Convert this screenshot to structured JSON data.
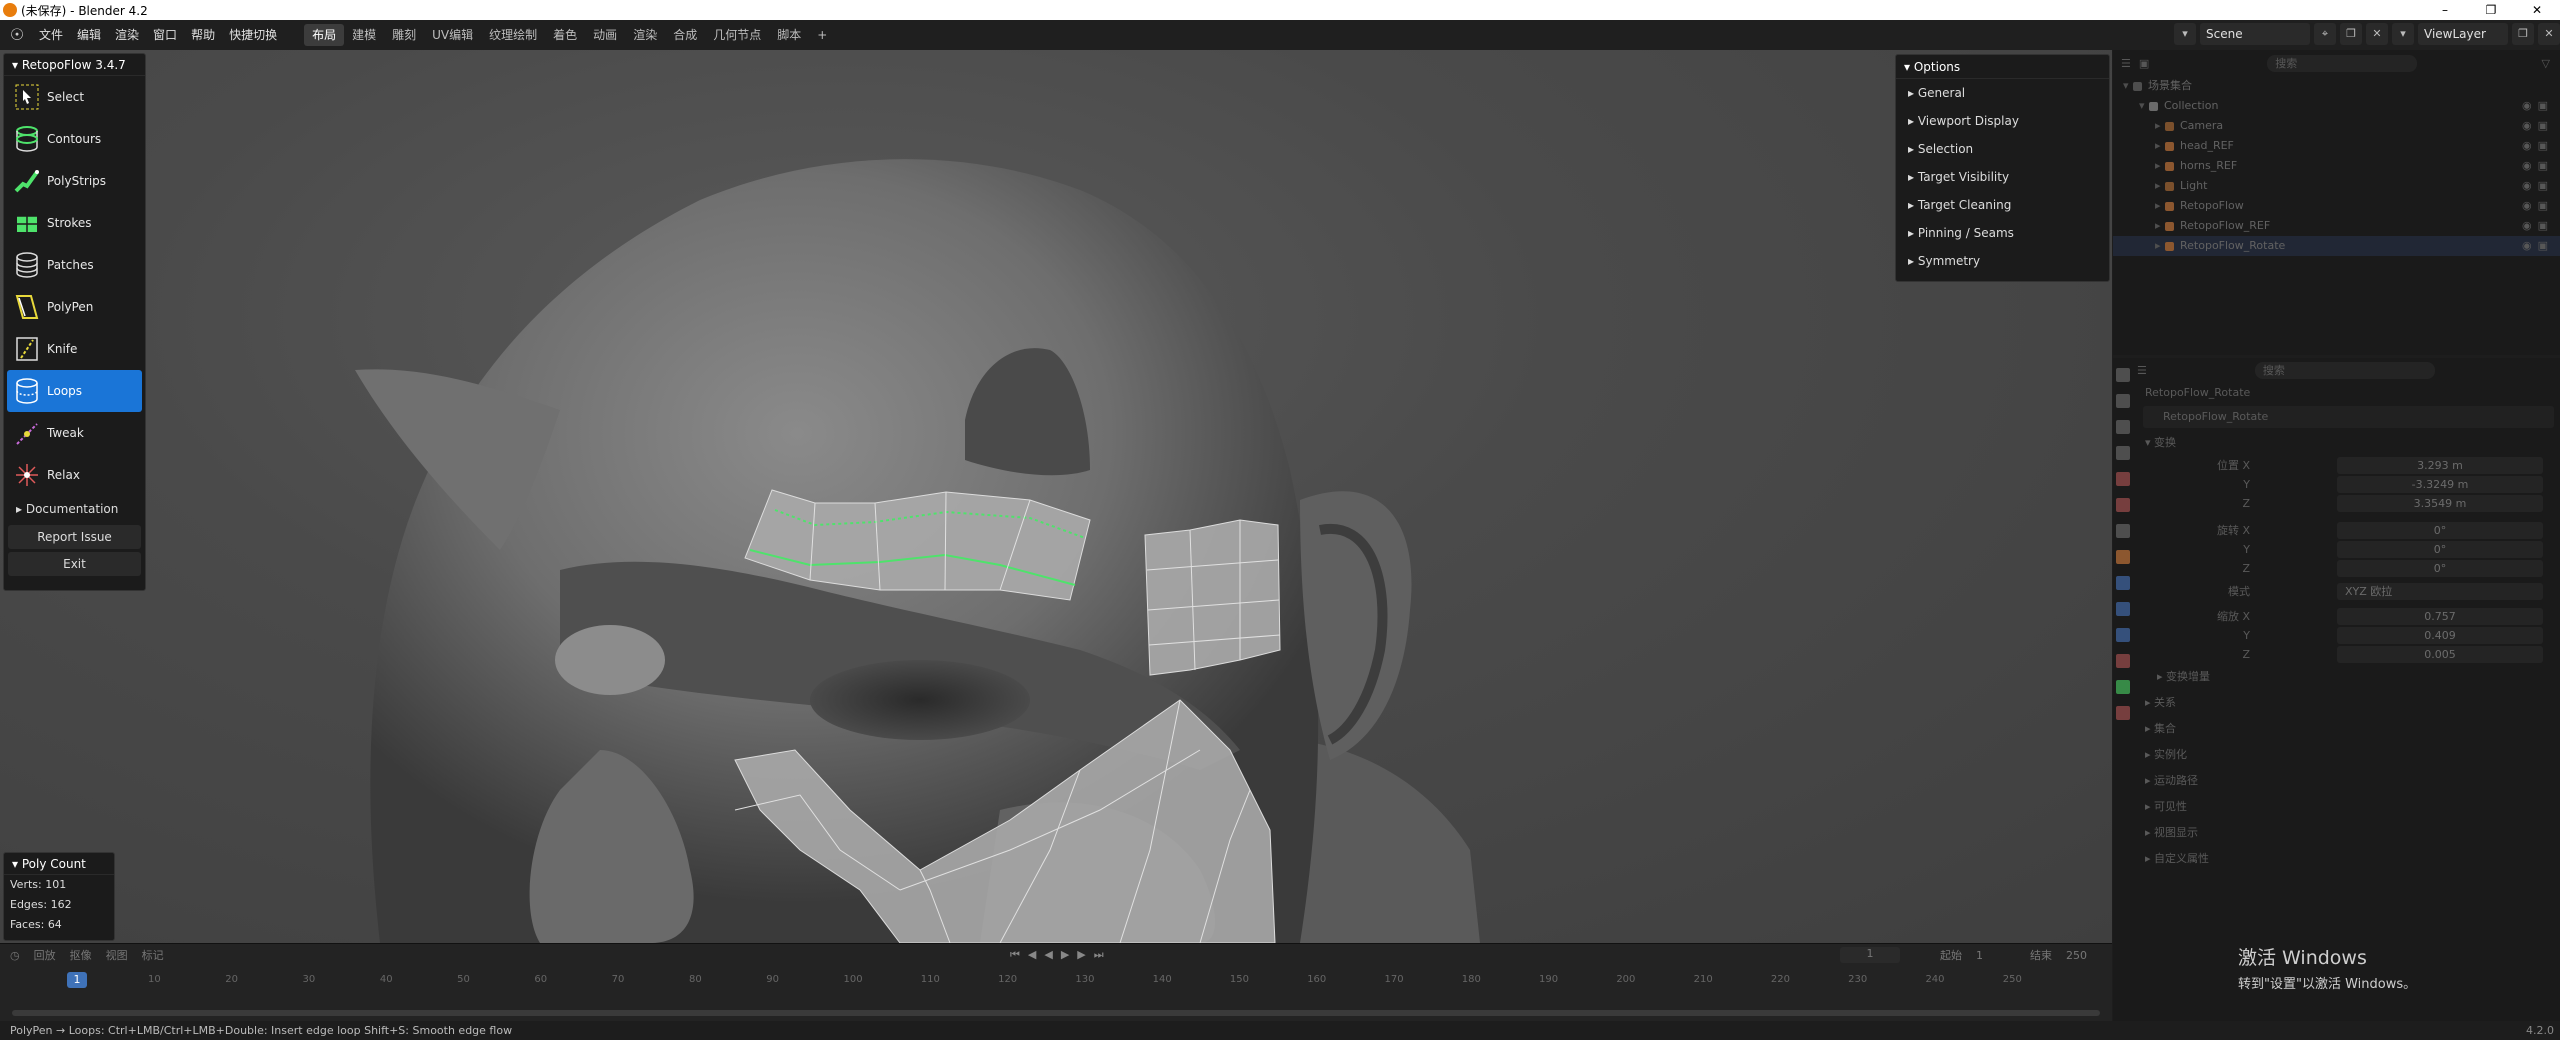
{
  "window": {
    "title": "(未保存) - Blender 4.2",
    "buttons": [
      "–",
      "❐",
      "✕"
    ]
  },
  "menubar": {
    "menus": [
      "文件",
      "编辑",
      "渲染",
      "窗口",
      "帮助",
      "快捷切换"
    ],
    "workspaces": [
      "布局",
      "建模",
      "雕刻",
      "UV编辑",
      "纹理绘制",
      "着色",
      "动画",
      "渲染",
      "合成",
      "几何节点",
      "脚本",
      "+"
    ],
    "active_workspace": "布局",
    "scene": "Scene",
    "view_layer": "ViewLayer"
  },
  "retopoflow": {
    "title": "RetopoFlow 3.4.7",
    "tools": [
      {
        "label": "Select",
        "icon": "select-icon"
      },
      {
        "label": "Contours",
        "icon": "contours-icon"
      },
      {
        "label": "PolyStrips",
        "icon": "polystrips-icon"
      },
      {
        "label": "Strokes",
        "icon": "strokes-icon"
      },
      {
        "label": "Patches",
        "icon": "patches-icon"
      },
      {
        "label": "PolyPen",
        "icon": "polypen-icon"
      },
      {
        "label": "Knife",
        "icon": "knife-icon"
      },
      {
        "label": "Loops",
        "icon": "loops-icon",
        "active": true
      },
      {
        "label": "Tweak",
        "icon": "tweak-icon"
      },
      {
        "label": "Relax",
        "icon": "relax-icon"
      }
    ],
    "documentation": "Documentation",
    "report_issue": "Report Issue",
    "exit": "Exit",
    "accent_color": "#1a75d7",
    "tool_color": "#4ee36b"
  },
  "options": {
    "title": "Options",
    "items": [
      "General",
      "Viewport Display",
      "Selection",
      "Target Visibility",
      "Target Cleaning",
      "Pinning / Seams",
      "Symmetry"
    ]
  },
  "poly_count": {
    "title": "Poly Count",
    "verts_label": "Verts:",
    "verts": "101",
    "edges_label": "Edges:",
    "edges": "162",
    "faces_label": "Faces:",
    "faces": "64"
  },
  "timeline": {
    "menus": [
      "回放",
      "抠像",
      "视图",
      "标记"
    ],
    "current_frame": "1",
    "frame_field": "1",
    "start_label": "起始",
    "start": "1",
    "end_label": "结束",
    "end": "250",
    "ticks": [
      "10",
      "20",
      "30",
      "40",
      "50",
      "60",
      "70",
      "80",
      "90",
      "100",
      "110",
      "120",
      "130",
      "140",
      "150",
      "160",
      "170",
      "180",
      "190",
      "200",
      "210",
      "220",
      "230",
      "240",
      "250"
    ]
  },
  "statusbar": {
    "hint": "PolyPen → Loops: Ctrl+LMB/Ctrl+LMB+Double: Insert edge loop    Shift+S: Smooth edge flow",
    "version": "4.2.0"
  },
  "outliner": {
    "search_placeholder": "搜索",
    "rows": [
      {
        "label": "场景集合",
        "depth": 0,
        "color": "#777777"
      },
      {
        "label": "Collection",
        "depth": 1,
        "color": "#aaaaaa"
      },
      {
        "label": "Camera",
        "depth": 2,
        "color": "#c97a3a"
      },
      {
        "label": "head_REF",
        "depth": 2,
        "color": "#e8873f"
      },
      {
        "label": "horns_REF",
        "depth": 2,
        "color": "#e8873f"
      },
      {
        "label": "Light",
        "depth": 2,
        "color": "#c97a3a"
      },
      {
        "label": "RetopoFlow",
        "depth": 2,
        "color": "#e8873f"
      },
      {
        "label": "RetopoFlow_REF",
        "depth": 2,
        "color": "#e8873f"
      },
      {
        "label": "RetopoFlow_Rotate",
        "depth": 2,
        "color": "#e8873f",
        "selected": true
      }
    ]
  },
  "properties": {
    "search_placeholder": "搜索",
    "object_name": "RetopoFlow_Rotate",
    "object_field": "RetopoFlow_Rotate",
    "section_transform": "变换",
    "location_label": "位置 X",
    "location": [
      "3.293 m",
      "-3.3249 m",
      "3.3549 m"
    ],
    "rotation_label": "旋转 X",
    "rotation": [
      "0°",
      "0°",
      "0°"
    ],
    "mode_label": "模式",
    "mode": "XYZ 欧拉",
    "scale_label": "缩放 X",
    "scale": [
      "0.757",
      "0.409",
      "0.005"
    ],
    "axis_y": "Y",
    "axis_z": "Z",
    "delta_transform": "变换增量",
    "sections": [
      "关系",
      "集合",
      "实例化",
      "运动路径",
      "可见性",
      "视图显示",
      "自定义属性"
    ]
  },
  "watermark": {
    "line1": "激活 Windows",
    "line2": "转到\"设置\"以激活 Windows。"
  }
}
